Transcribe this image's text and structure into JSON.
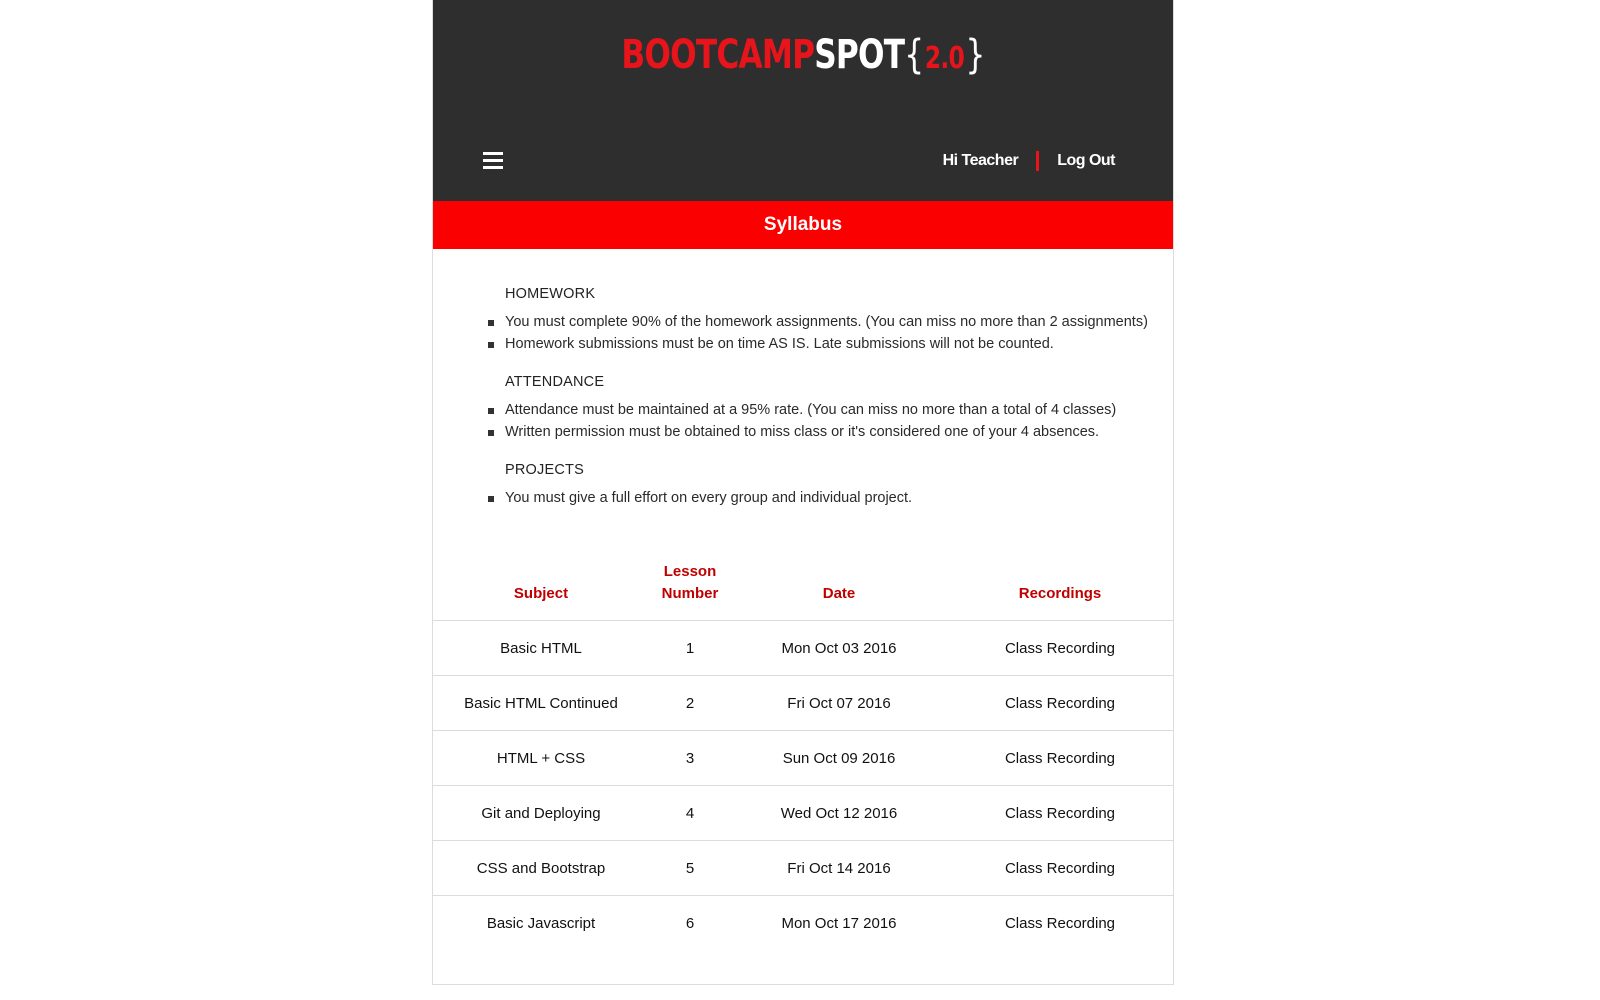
{
  "header": {
    "logo": {
      "part1": "BOOTCAMP",
      "part2": "SPOT",
      "brace_open": "{",
      "version": "2.0",
      "brace_close": "}"
    },
    "greeting": "Hi Teacher",
    "logout_label": "Log Out"
  },
  "page_title": "Syllabus",
  "rules": [
    {
      "heading": "HOMEWORK",
      "items": [
        "You must complete 90% of the homework assignments. (You can miss no more than 2 assignments)",
        "Homework submissions must be on time AS IS. Late submissions will not be counted."
      ]
    },
    {
      "heading": "ATTENDANCE",
      "items": [
        "Attendance must be maintained at a 95% rate. (You can miss no more than a total of 4 classes)",
        "Written permission must be obtained to miss class or it's considered one of your 4 absences."
      ]
    },
    {
      "heading": "PROJECTS",
      "items": [
        "You must give a full effort on every group and individual project."
      ]
    }
  ],
  "table": {
    "headers": {
      "subject": "Subject",
      "lesson_line1": "Lesson",
      "lesson_line2": "Number",
      "date": "Date",
      "recordings": "Recordings"
    },
    "rows": [
      {
        "subject": "Basic HTML",
        "lesson": "1",
        "date": "Mon Oct 03 2016",
        "recording": "Class Recording"
      },
      {
        "subject": "Basic HTML Continued",
        "lesson": "2",
        "date": "Fri Oct 07 2016",
        "recording": "Class Recording"
      },
      {
        "subject": "HTML + CSS",
        "lesson": "3",
        "date": "Sun Oct 09 2016",
        "recording": "Class Recording"
      },
      {
        "subject": "Git and Deploying",
        "lesson": "4",
        "date": "Wed Oct 12 2016",
        "recording": "Class Recording"
      },
      {
        "subject": "CSS and Bootstrap",
        "lesson": "5",
        "date": "Fri Oct 14 2016",
        "recording": "Class Recording"
      },
      {
        "subject": "Basic Javascript",
        "lesson": "6",
        "date": "Mon Oct 17 2016",
        "recording": "Class Recording"
      }
    ]
  },
  "icons": {
    "menu": "hamburger-menu-icon"
  },
  "colors": {
    "header_bg": "#2e2e2e",
    "accent_red": "#fa0000",
    "heading_red": "#c00000"
  }
}
